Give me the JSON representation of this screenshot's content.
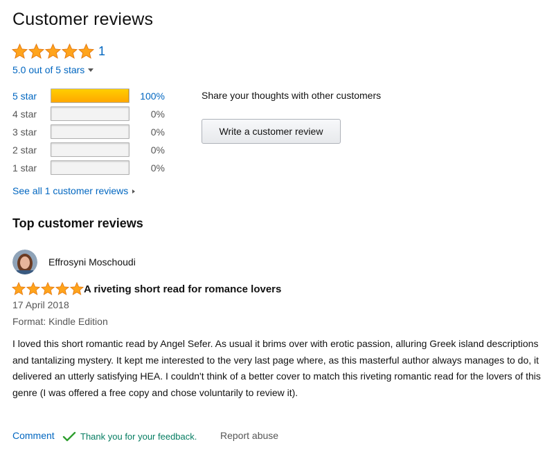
{
  "header": {
    "title": "Customer reviews",
    "review_count": "1",
    "average_rating_text": "5.0 out of 5 stars",
    "rating_value": 5
  },
  "histogram": [
    {
      "label": "5 star",
      "percent_text": "100%",
      "fill_fraction": 1.0,
      "linked": true
    },
    {
      "label": "4 star",
      "percent_text": "0%",
      "fill_fraction": 0.0,
      "linked": false
    },
    {
      "label": "3 star",
      "percent_text": "0%",
      "fill_fraction": 0.0,
      "linked": false
    },
    {
      "label": "2 star",
      "percent_text": "0%",
      "fill_fraction": 0.0,
      "linked": false
    },
    {
      "label": "1 star",
      "percent_text": "0%",
      "fill_fraction": 0.0,
      "linked": false
    }
  ],
  "see_all_link": "See all 1 customer reviews",
  "share": {
    "text": "Share your thoughts with other customers",
    "button_label": "Write a customer review"
  },
  "top_reviews": {
    "heading": "Top customer reviews",
    "review": {
      "reviewer": "Effrosyni Moschoudi",
      "rating_value": 5,
      "title": "A riveting short read for romance lovers",
      "date": "17 April 2018",
      "format": "Format: Kindle Edition",
      "body": "I loved this short romantic read by Angel Sefer. As usual it brims over with erotic passion, alluring Greek island descriptions and tantalizing mystery. It kept me interested to the very last page where, as this masterful author always manages to do, it delivered an utterly satisfying HEA. I couldn't think of a better cover to match this riveting romantic read for the lovers of this genre (I was offered a free copy and chose voluntarily to review it).",
      "comment_label": "Comment",
      "feedback_text": "Thank you for your feedback.",
      "report_label": "Report abuse"
    }
  },
  "colors": {
    "link": "#0066c0",
    "star_fill": "#ffa41c",
    "star_stroke": "#e47911",
    "feedback_green": "#067d62"
  },
  "icons": {
    "star": "star-icon",
    "caret": "caret-down-icon",
    "check": "check-icon",
    "avatar": "avatar"
  }
}
